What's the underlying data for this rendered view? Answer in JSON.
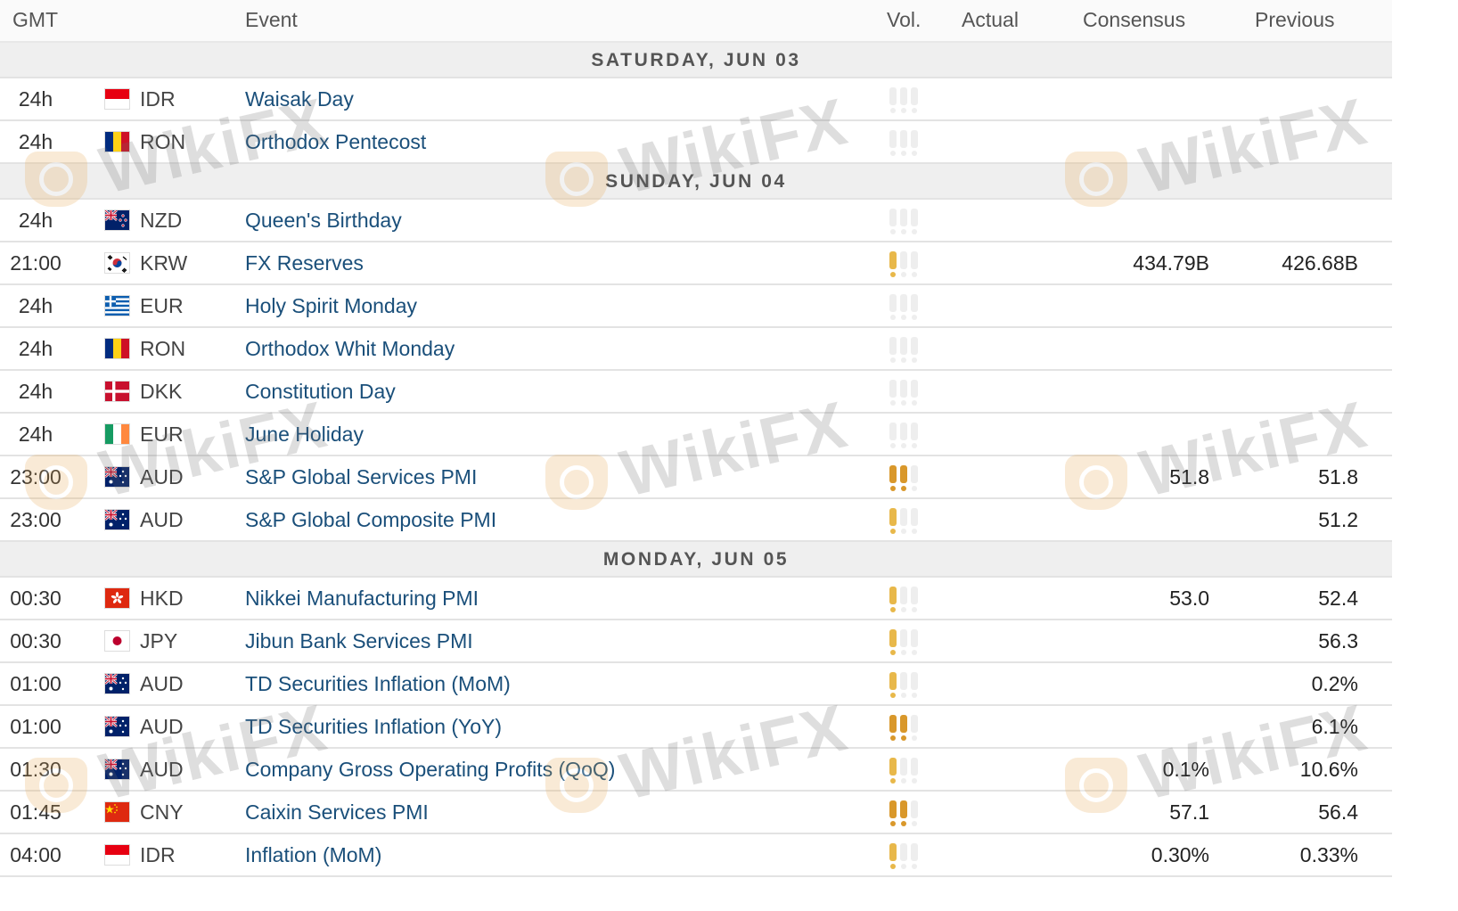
{
  "header": {
    "gmt": "GMT",
    "event": "Event",
    "vol": "Vol.",
    "actual": "Actual",
    "consensus": "Consensus",
    "previous": "Previous"
  },
  "colors": {
    "vol_high": "#d9982b",
    "vol_medium": "#e8b84a",
    "vol_low": "#eeeeee",
    "event_text": "#1a4f7a",
    "day_bg": "#efefef"
  },
  "watermark_text": "WikiFX",
  "groups": [
    {
      "day": "SATURDAY, JUN 03",
      "rows": [
        {
          "time": "24h",
          "flag": "id",
          "currency": "IDR",
          "event": "Waisak Day",
          "vol": 0,
          "actual": "",
          "consensus": "",
          "previous": ""
        },
        {
          "time": "24h",
          "flag": "ro",
          "currency": "RON",
          "event": "Orthodox Pentecost",
          "vol": 0,
          "actual": "",
          "consensus": "",
          "previous": ""
        }
      ]
    },
    {
      "day": "SUNDAY, JUN 04",
      "rows": [
        {
          "time": "24h",
          "flag": "nz",
          "currency": "NZD",
          "event": "Queen's Birthday",
          "vol": 0,
          "actual": "",
          "consensus": "",
          "previous": ""
        },
        {
          "time": "21:00",
          "flag": "kr",
          "currency": "KRW",
          "event": "FX Reserves",
          "vol": 1,
          "actual": "",
          "consensus": "434.79B",
          "previous": "426.68B"
        },
        {
          "time": "24h",
          "flag": "gr",
          "currency": "EUR",
          "event": "Holy Spirit Monday",
          "vol": 0,
          "actual": "",
          "consensus": "",
          "previous": ""
        },
        {
          "time": "24h",
          "flag": "ro",
          "currency": "RON",
          "event": "Orthodox Whit Monday",
          "vol": 0,
          "actual": "",
          "consensus": "",
          "previous": ""
        },
        {
          "time": "24h",
          "flag": "dk",
          "currency": "DKK",
          "event": "Constitution Day",
          "vol": 0,
          "actual": "",
          "consensus": "",
          "previous": ""
        },
        {
          "time": "24h",
          "flag": "ie",
          "currency": "EUR",
          "event": "June Holiday",
          "vol": 0,
          "actual": "",
          "consensus": "",
          "previous": ""
        },
        {
          "time": "23:00",
          "flag": "au",
          "currency": "AUD",
          "event": "S&P Global Services PMI",
          "vol": 2,
          "actual": "",
          "consensus": "51.8",
          "previous": "51.8"
        },
        {
          "time": "23:00",
          "flag": "au",
          "currency": "AUD",
          "event": "S&P Global Composite PMI",
          "vol": 1,
          "actual": "",
          "consensus": "",
          "previous": "51.2"
        }
      ]
    },
    {
      "day": "MONDAY, JUN 05",
      "rows": [
        {
          "time": "00:30",
          "flag": "hk",
          "currency": "HKD",
          "event": "Nikkei Manufacturing PMI",
          "vol": 1,
          "actual": "",
          "consensus": "53.0",
          "previous": "52.4"
        },
        {
          "time": "00:30",
          "flag": "jp",
          "currency": "JPY",
          "event": "Jibun Bank Services PMI",
          "vol": 1,
          "actual": "",
          "consensus": "",
          "previous": "56.3"
        },
        {
          "time": "01:00",
          "flag": "au",
          "currency": "AUD",
          "event": "TD Securities Inflation (MoM)",
          "vol": 1,
          "actual": "",
          "consensus": "",
          "previous": "0.2%"
        },
        {
          "time": "01:00",
          "flag": "au",
          "currency": "AUD",
          "event": "TD Securities Inflation (YoY)",
          "vol": 2,
          "actual": "",
          "consensus": "",
          "previous": "6.1%"
        },
        {
          "time": "01:30",
          "flag": "au",
          "currency": "AUD",
          "event": "Company Gross Operating Profits (QoQ)",
          "vol": 1,
          "actual": "",
          "consensus": "0.1%",
          "previous": "10.6%"
        },
        {
          "time": "01:45",
          "flag": "cn",
          "currency": "CNY",
          "event": "Caixin Services PMI",
          "vol": 2,
          "actual": "",
          "consensus": "57.1",
          "previous": "56.4"
        },
        {
          "time": "04:00",
          "flag": "id",
          "currency": "IDR",
          "event": "Inflation (MoM)",
          "vol": 1,
          "actual": "",
          "consensus": "0.30%",
          "previous": "0.33%"
        }
      ]
    }
  ]
}
